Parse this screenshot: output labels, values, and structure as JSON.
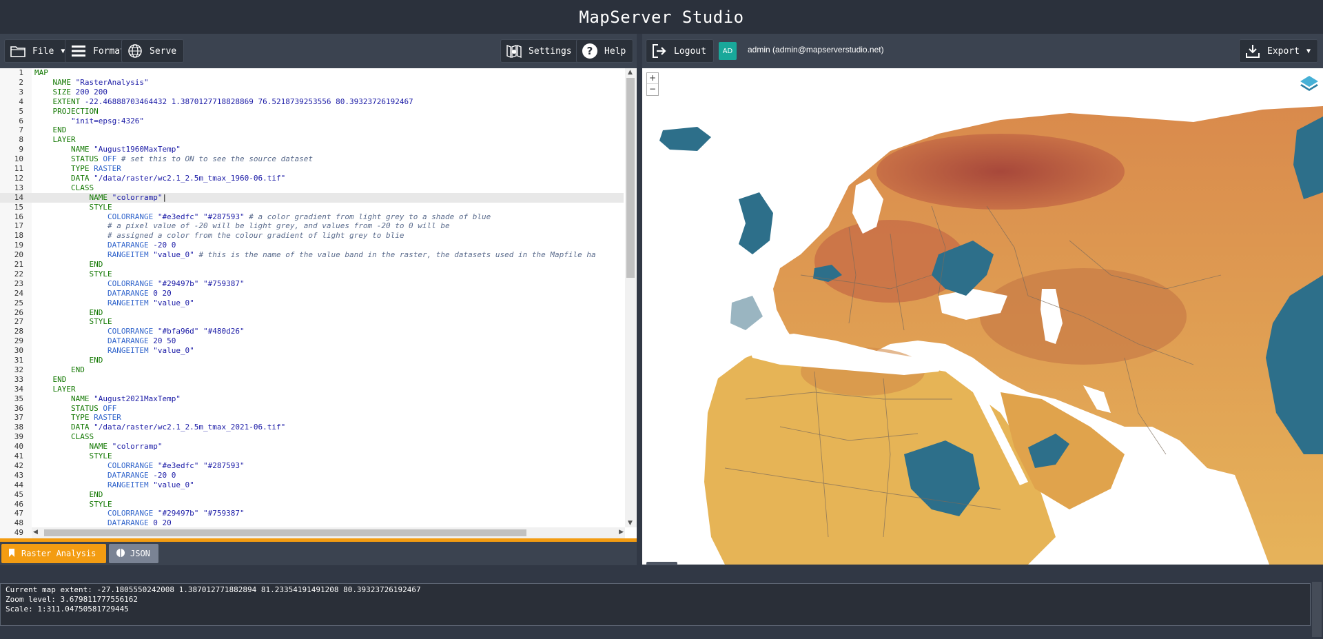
{
  "app": {
    "title": "MapServer Studio"
  },
  "toolbar_left": {
    "file_label": "File",
    "format_label": "Format",
    "serve_label": "Serve",
    "settings_label": "Settings",
    "help_label": "Help"
  },
  "toolbar_right": {
    "logout_label": "Logout",
    "user_initials": "AD",
    "user_name": "admin (admin@mapserverstudio.net)",
    "export_label": "Export"
  },
  "editor": {
    "active_line": 14,
    "lines": [
      {
        "n": "1",
        "segs": [
          {
            "c": "kw",
            "t": "MAP"
          }
        ]
      },
      {
        "n": "2",
        "segs": [
          {
            "c": "pl",
            "t": "    "
          },
          {
            "c": "kw",
            "t": "NAME "
          },
          {
            "c": "str",
            "t": "\"RasterAnalysis\""
          }
        ]
      },
      {
        "n": "3",
        "segs": [
          {
            "c": "pl",
            "t": "    "
          },
          {
            "c": "kw",
            "t": "SIZE "
          },
          {
            "c": "str",
            "t": "200 200"
          }
        ]
      },
      {
        "n": "4",
        "segs": [
          {
            "c": "pl",
            "t": "    "
          },
          {
            "c": "kw",
            "t": "EXTENT "
          },
          {
            "c": "str",
            "t": "-22.46888703464432 1.3870127718828869 76.5218739253556 80.39323726192467"
          }
        ]
      },
      {
        "n": "5",
        "segs": [
          {
            "c": "pl",
            "t": "    "
          },
          {
            "c": "kw",
            "t": "PROJECTION"
          }
        ]
      },
      {
        "n": "6",
        "segs": [
          {
            "c": "pl",
            "t": "        "
          },
          {
            "c": "str",
            "t": "\"init=epsg:4326\""
          }
        ]
      },
      {
        "n": "7",
        "segs": [
          {
            "c": "pl",
            "t": "    "
          },
          {
            "c": "kw",
            "t": "END"
          }
        ]
      },
      {
        "n": "8",
        "segs": [
          {
            "c": "pl",
            "t": "    "
          },
          {
            "c": "kw",
            "t": "LAYER"
          }
        ]
      },
      {
        "n": "9",
        "segs": [
          {
            "c": "pl",
            "t": "        "
          },
          {
            "c": "kw",
            "t": "NAME "
          },
          {
            "c": "str",
            "t": "\"August1960MaxTemp\""
          }
        ]
      },
      {
        "n": "10",
        "segs": [
          {
            "c": "pl",
            "t": "        "
          },
          {
            "c": "kw",
            "t": "STATUS "
          },
          {
            "c": "ty",
            "t": "OFF "
          },
          {
            "c": "cm",
            "t": "# set this to ON to see the source dataset"
          }
        ]
      },
      {
        "n": "11",
        "segs": [
          {
            "c": "pl",
            "t": "        "
          },
          {
            "c": "kw",
            "t": "TYPE "
          },
          {
            "c": "ty",
            "t": "RASTER"
          }
        ]
      },
      {
        "n": "12",
        "segs": [
          {
            "c": "pl",
            "t": "        "
          },
          {
            "c": "kw",
            "t": "DATA "
          },
          {
            "c": "str",
            "t": "\"/data/raster/wc2.1_2.5m_tmax_1960-06.tif\""
          }
        ]
      },
      {
        "n": "13",
        "segs": [
          {
            "c": "pl",
            "t": "        "
          },
          {
            "c": "kw",
            "t": "CLASS"
          }
        ]
      },
      {
        "n": "14",
        "segs": [
          {
            "c": "pl",
            "t": "            "
          },
          {
            "c": "kw",
            "t": "NAME "
          },
          {
            "c": "str",
            "t": "\"colorramp\""
          },
          {
            "c": "pl",
            "t": "|"
          }
        ]
      },
      {
        "n": "15",
        "segs": [
          {
            "c": "pl",
            "t": "            "
          },
          {
            "c": "kw",
            "t": "STYLE"
          }
        ]
      },
      {
        "n": "16",
        "segs": [
          {
            "c": "pl",
            "t": "                "
          },
          {
            "c": "ty",
            "t": "COLORRANGE "
          },
          {
            "c": "str",
            "t": "\"#e3edfc\" \"#287593\" "
          },
          {
            "c": "cm",
            "t": "# a color gradient from light grey to a shade of blue"
          }
        ]
      },
      {
        "n": "17",
        "segs": [
          {
            "c": "pl",
            "t": "                "
          },
          {
            "c": "cm",
            "t": "# a pixel value of -20 will be light grey, and values from -20 to 0 will be"
          }
        ]
      },
      {
        "n": "18",
        "segs": [
          {
            "c": "pl",
            "t": "                "
          },
          {
            "c": "cm",
            "t": "# assigned a color from the colour gradient of light grey to blie"
          }
        ]
      },
      {
        "n": "19",
        "segs": [
          {
            "c": "pl",
            "t": "                "
          },
          {
            "c": "ty",
            "t": "DATARANGE "
          },
          {
            "c": "str",
            "t": "-20 0"
          }
        ]
      },
      {
        "n": "20",
        "segs": [
          {
            "c": "pl",
            "t": "                "
          },
          {
            "c": "ty",
            "t": "RANGEITEM "
          },
          {
            "c": "str",
            "t": "\"value_0\" "
          },
          {
            "c": "cm",
            "t": "# this is the name of the value band in the raster, the datasets used in the Mapfile ha"
          }
        ]
      },
      {
        "n": "21",
        "segs": [
          {
            "c": "pl",
            "t": "            "
          },
          {
            "c": "kw",
            "t": "END"
          }
        ]
      },
      {
        "n": "22",
        "segs": [
          {
            "c": "pl",
            "t": "            "
          },
          {
            "c": "kw",
            "t": "STYLE"
          }
        ]
      },
      {
        "n": "23",
        "segs": [
          {
            "c": "pl",
            "t": "                "
          },
          {
            "c": "ty",
            "t": "COLORRANGE "
          },
          {
            "c": "str",
            "t": "\"#29497b\" \"#759387\""
          }
        ]
      },
      {
        "n": "24",
        "segs": [
          {
            "c": "pl",
            "t": "                "
          },
          {
            "c": "ty",
            "t": "DATARANGE "
          },
          {
            "c": "str",
            "t": "0 20"
          }
        ]
      },
      {
        "n": "25",
        "segs": [
          {
            "c": "pl",
            "t": "                "
          },
          {
            "c": "ty",
            "t": "RANGEITEM "
          },
          {
            "c": "str",
            "t": "\"value_0\""
          }
        ]
      },
      {
        "n": "26",
        "segs": [
          {
            "c": "pl",
            "t": "            "
          },
          {
            "c": "kw",
            "t": "END"
          }
        ]
      },
      {
        "n": "27",
        "segs": [
          {
            "c": "pl",
            "t": "            "
          },
          {
            "c": "kw",
            "t": "STYLE"
          }
        ]
      },
      {
        "n": "28",
        "segs": [
          {
            "c": "pl",
            "t": "                "
          },
          {
            "c": "ty",
            "t": "COLORRANGE "
          },
          {
            "c": "str",
            "t": "\"#bfa96d\" \"#480d26\""
          }
        ]
      },
      {
        "n": "29",
        "segs": [
          {
            "c": "pl",
            "t": "                "
          },
          {
            "c": "ty",
            "t": "DATARANGE "
          },
          {
            "c": "str",
            "t": "20 50"
          }
        ]
      },
      {
        "n": "30",
        "segs": [
          {
            "c": "pl",
            "t": "                "
          },
          {
            "c": "ty",
            "t": "RANGEITEM "
          },
          {
            "c": "str",
            "t": "\"value_0\""
          }
        ]
      },
      {
        "n": "31",
        "segs": [
          {
            "c": "pl",
            "t": "            "
          },
          {
            "c": "kw",
            "t": "END"
          }
        ]
      },
      {
        "n": "32",
        "segs": [
          {
            "c": "pl",
            "t": "        "
          },
          {
            "c": "kw",
            "t": "END"
          }
        ]
      },
      {
        "n": "33",
        "segs": [
          {
            "c": "pl",
            "t": "    "
          },
          {
            "c": "kw",
            "t": "END"
          }
        ]
      },
      {
        "n": "34",
        "segs": [
          {
            "c": "pl",
            "t": "    "
          },
          {
            "c": "kw",
            "t": "LAYER"
          }
        ]
      },
      {
        "n": "35",
        "segs": [
          {
            "c": "pl",
            "t": "        "
          },
          {
            "c": "kw",
            "t": "NAME "
          },
          {
            "c": "str",
            "t": "\"August2021MaxTemp\""
          }
        ]
      },
      {
        "n": "36",
        "segs": [
          {
            "c": "pl",
            "t": "        "
          },
          {
            "c": "kw",
            "t": "STATUS "
          },
          {
            "c": "ty",
            "t": "OFF"
          }
        ]
      },
      {
        "n": "37",
        "segs": [
          {
            "c": "pl",
            "t": "        "
          },
          {
            "c": "kw",
            "t": "TYPE "
          },
          {
            "c": "ty",
            "t": "RASTER"
          }
        ]
      },
      {
        "n": "38",
        "segs": [
          {
            "c": "pl",
            "t": "        "
          },
          {
            "c": "kw",
            "t": "DATA "
          },
          {
            "c": "str",
            "t": "\"/data/raster/wc2.1_2.5m_tmax_2021-06.tif\""
          }
        ]
      },
      {
        "n": "39",
        "segs": [
          {
            "c": "pl",
            "t": "        "
          },
          {
            "c": "kw",
            "t": "CLASS"
          }
        ]
      },
      {
        "n": "40",
        "segs": [
          {
            "c": "pl",
            "t": "            "
          },
          {
            "c": "kw",
            "t": "NAME "
          },
          {
            "c": "str",
            "t": "\"colorramp\""
          }
        ]
      },
      {
        "n": "41",
        "segs": [
          {
            "c": "pl",
            "t": "            "
          },
          {
            "c": "kw",
            "t": "STYLE"
          }
        ]
      },
      {
        "n": "42",
        "segs": [
          {
            "c": "pl",
            "t": "                "
          },
          {
            "c": "ty",
            "t": "COLORRANGE "
          },
          {
            "c": "str",
            "t": "\"#e3edfc\" \"#287593\""
          }
        ]
      },
      {
        "n": "43",
        "segs": [
          {
            "c": "pl",
            "t": "                "
          },
          {
            "c": "ty",
            "t": "DATARANGE "
          },
          {
            "c": "str",
            "t": "-20 0"
          }
        ]
      },
      {
        "n": "44",
        "segs": [
          {
            "c": "pl",
            "t": "                "
          },
          {
            "c": "ty",
            "t": "RANGEITEM "
          },
          {
            "c": "str",
            "t": "\"value_0\""
          }
        ]
      },
      {
        "n": "45",
        "segs": [
          {
            "c": "pl",
            "t": "            "
          },
          {
            "c": "kw",
            "t": "END"
          }
        ]
      },
      {
        "n": "46",
        "segs": [
          {
            "c": "pl",
            "t": "            "
          },
          {
            "c": "kw",
            "t": "STYLE"
          }
        ]
      },
      {
        "n": "47",
        "segs": [
          {
            "c": "pl",
            "t": "                "
          },
          {
            "c": "ty",
            "t": "COLORRANGE "
          },
          {
            "c": "str",
            "t": "\"#29497b\" \"#759387\""
          }
        ]
      },
      {
        "n": "48",
        "segs": [
          {
            "c": "pl",
            "t": "                "
          },
          {
            "c": "ty",
            "t": "DATARANGE "
          },
          {
            "c": "str",
            "t": "0 20"
          }
        ]
      },
      {
        "n": "49",
        "segs": []
      }
    ]
  },
  "tabs": [
    {
      "label": "Raster Analysis",
      "active": true,
      "icon": "bookmark-icon"
    },
    {
      "label": "JSON",
      "active": false,
      "icon": "globe-icon"
    }
  ],
  "map": {
    "zoom_in": "+",
    "zoom_out": "−"
  },
  "status": {
    "extent": "Current map extent: -27.1805550242008 1.387012771882894 81.23354191491208 80.39323726192467",
    "zoom": "Zoom level: 3.679811777556162",
    "scale": "Scale: 1:311.04750581729445"
  },
  "colors": {
    "accent": "#f39c12",
    "map_warm": "#e0a84c",
    "map_hot": "#a8453a",
    "map_cold": "#2d6f8a"
  }
}
